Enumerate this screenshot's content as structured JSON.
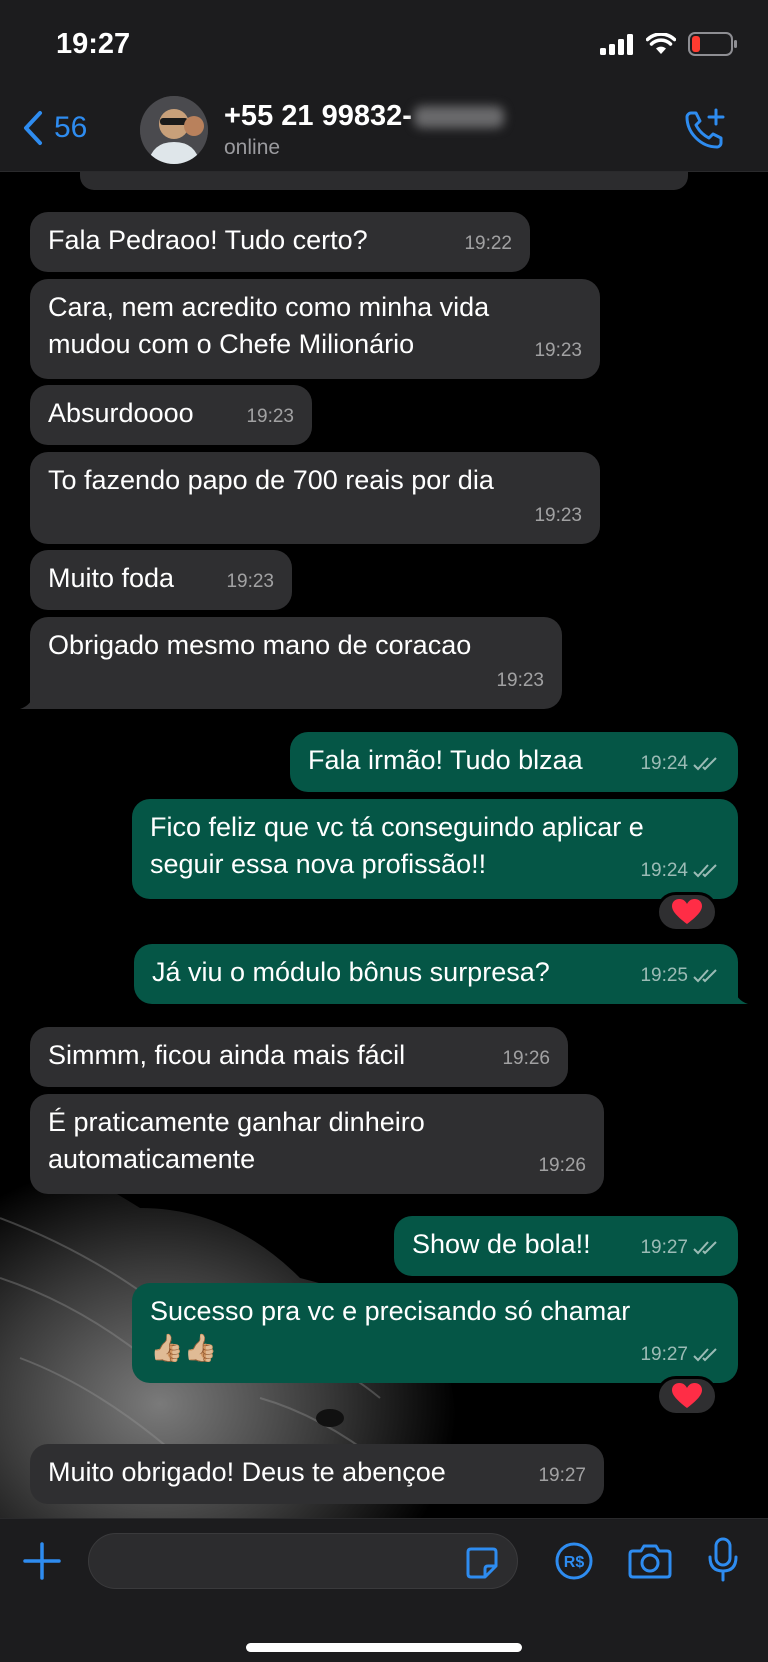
{
  "status_bar": {
    "time": "19:27"
  },
  "header": {
    "back_count": "56",
    "contact_name": "+55 21 99832-",
    "contact_status": "online"
  },
  "messages": [
    {
      "dir": "in",
      "text": "Fala Pedraoo! Tudo certo?",
      "time": "19:22"
    },
    {
      "dir": "in",
      "text": "Cara, nem acredito como minha vida mudou com o Chefe Milionário",
      "time": "19:23"
    },
    {
      "dir": "in",
      "text": "Absurdoooo",
      "time": "19:23"
    },
    {
      "dir": "in",
      "text": "To fazendo papo de 700 reais por dia",
      "time": "19:23"
    },
    {
      "dir": "in",
      "text": "Muito foda",
      "time": "19:23"
    },
    {
      "dir": "in",
      "text": "Obrigado mesmo mano de coracao",
      "time": "19:23"
    },
    {
      "dir": "out",
      "text": "Fala irmão! Tudo blzaa",
      "time": "19:24"
    },
    {
      "dir": "out",
      "text": "Fico feliz que vc tá conseguindo aplicar e seguir essa nova profissão!!",
      "time": "19:24",
      "reaction": "heart"
    },
    {
      "dir": "out",
      "text": "Já viu o módulo bônus surpresa?",
      "time": "19:25"
    },
    {
      "dir": "in",
      "text": "Simmm, ficou ainda mais fácil",
      "time": "19:26"
    },
    {
      "dir": "in",
      "text": "É praticamente ganhar dinheiro automaticamente",
      "time": "19:26"
    },
    {
      "dir": "out",
      "text": "Show de bola!!",
      "time": "19:27"
    },
    {
      "dir": "out",
      "text": "Sucesso pra vc e precisando só chamar",
      "emoji": "👍🏼👍🏼",
      "time": "19:27",
      "reaction": "heart"
    },
    {
      "dir": "in",
      "text": "Muito obrigado! Deus te abençoe",
      "time": "19:27"
    }
  ],
  "colors": {
    "incoming": "#2f2f31",
    "outgoing": "#055646",
    "accent": "#2e8cf0",
    "reaction": "#ff2d46"
  },
  "icons": {
    "status": [
      "signal-icon",
      "wifi-icon",
      "battery-low-icon"
    ],
    "header": [
      "back-chevron-icon",
      "add-call-icon"
    ],
    "input": [
      "plus-icon",
      "sticker-icon",
      "payment-icon",
      "camera-icon",
      "microphone-icon"
    ],
    "reaction": "heart-icon"
  }
}
